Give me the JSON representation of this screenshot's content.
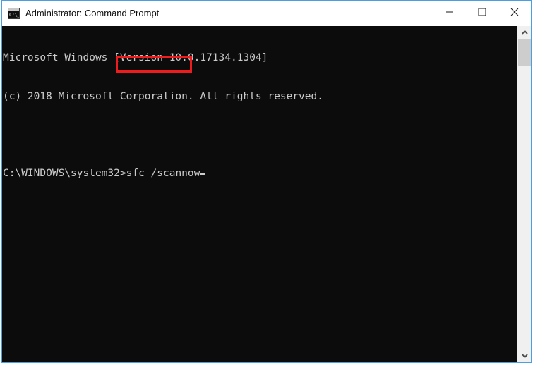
{
  "window": {
    "title": "Administrator: Command Prompt",
    "icon": "command-prompt-icon",
    "icon_glyph": "C:\\_",
    "border_color": "#4a9fe0",
    "titlebar_bg": "#ffffff",
    "controls": {
      "minimize_label": "Minimize",
      "maximize_label": "Maximize",
      "close_label": "Close"
    }
  },
  "console": {
    "background": "#0c0c0c",
    "foreground": "#cccccc",
    "lines": [
      "Microsoft Windows [Version 10.0.17134.1304]",
      "(c) 2018 Microsoft Corporation. All rights reserved.",
      ""
    ],
    "prompt": "C:\\WINDOWS\\system32>",
    "command": "sfc /scannow",
    "cursor": "block-caret"
  },
  "annotation": {
    "highlight_color": "#ee1c1c",
    "highlight_target": "sfc /scannow"
  },
  "scrollbar": {
    "up_arrow": "▲",
    "down_arrow": "▼",
    "track_color": "#f0f0f0",
    "thumb_color": "#cdcdcd"
  }
}
